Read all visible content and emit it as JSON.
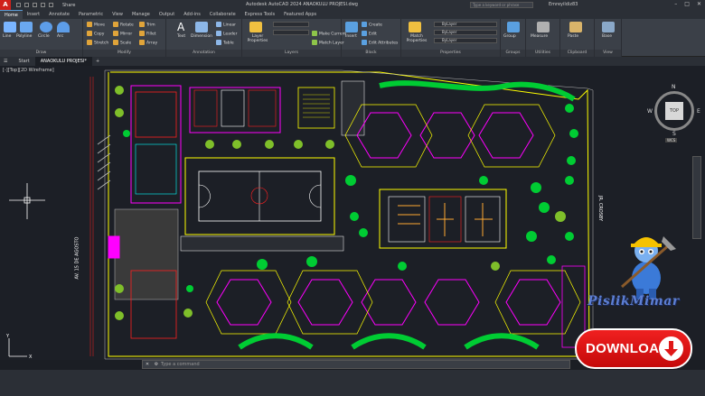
{
  "titlebar": {
    "logo": "A",
    "share": "Share",
    "title": "Autodesk AutoCAD 2024   ANAOKULU PROJESI.dwg",
    "search_placeholder": "Type a keyword or phrase",
    "user": "Emreyildiz83"
  },
  "tabs": [
    "Home",
    "Insert",
    "Annotate",
    "Parametric",
    "View",
    "Manage",
    "Output",
    "Add-ins",
    "Collaborate",
    "Express Tools",
    "Featured Apps"
  ],
  "ribbon": {
    "draw": {
      "name": "Draw",
      "line": "Line",
      "polyline": "Polyline",
      "circle": "Circle",
      "arc": "Arc"
    },
    "modify": {
      "name": "Modify",
      "move": "Move",
      "rotate": "Rotate",
      "trim": "Trim",
      "copy": "Copy",
      "mirror": "Mirror",
      "fillet": "Fillet",
      "stretch": "Stretch",
      "scale": "Scale",
      "array": "Array"
    },
    "annotation": {
      "name": "Annotation",
      "text": "Text",
      "dimension": "Dimension",
      "linear": "Linear",
      "leader": "Leader",
      "table": "Table"
    },
    "layers": {
      "name": "Layers",
      "layer_properties": "Layer Properties",
      "make_current": "Make Current",
      "match_layer": "Match Layer"
    },
    "block": {
      "name": "Block",
      "insert": "Insert",
      "create": "Create",
      "edit": "Edit",
      "edit_attributes": "Edit Attributes"
    },
    "properties": {
      "name": "Properties",
      "match_properties": "Match Properties",
      "bylayer_1": "ByLayer",
      "bylayer_2": "ByLayer",
      "bylayer_3": "ByLayer"
    },
    "groups": {
      "name": "Groups",
      "group": "Group"
    },
    "utilities": {
      "name": "Utilities",
      "measure": "Measure"
    },
    "clipboard": {
      "name": "Clipboard",
      "paste": "Paste"
    },
    "view": {
      "name": "View",
      "base": "Base"
    }
  },
  "doctabs": {
    "start": "Start",
    "file": "ANAOKULU PROJESI*"
  },
  "viewport": {
    "label": "[-][Top][2D Wireframe]",
    "viewcube": {
      "top": "TOP",
      "n": "N",
      "s": "S",
      "e": "E",
      "w": "W",
      "wcs": "WCS"
    },
    "street_left": "AV. 15 DE AGOSTO",
    "street_right": "JR. CROSBY"
  },
  "commandline": {
    "placeholder": "Type a command"
  },
  "branding": {
    "logo_text": "PislikMimar",
    "download_label": "DOWNLOAD"
  },
  "colors": {
    "background": "#1c1f26",
    "ribbon": "#3b4048",
    "download": "#e01818",
    "cad_yellow": "#ffff00",
    "cad_green": "#00cc33",
    "cad_magenta": "#ff00ff",
    "cad_red": "#ff2020",
    "cad_cyan": "#00ffff"
  }
}
